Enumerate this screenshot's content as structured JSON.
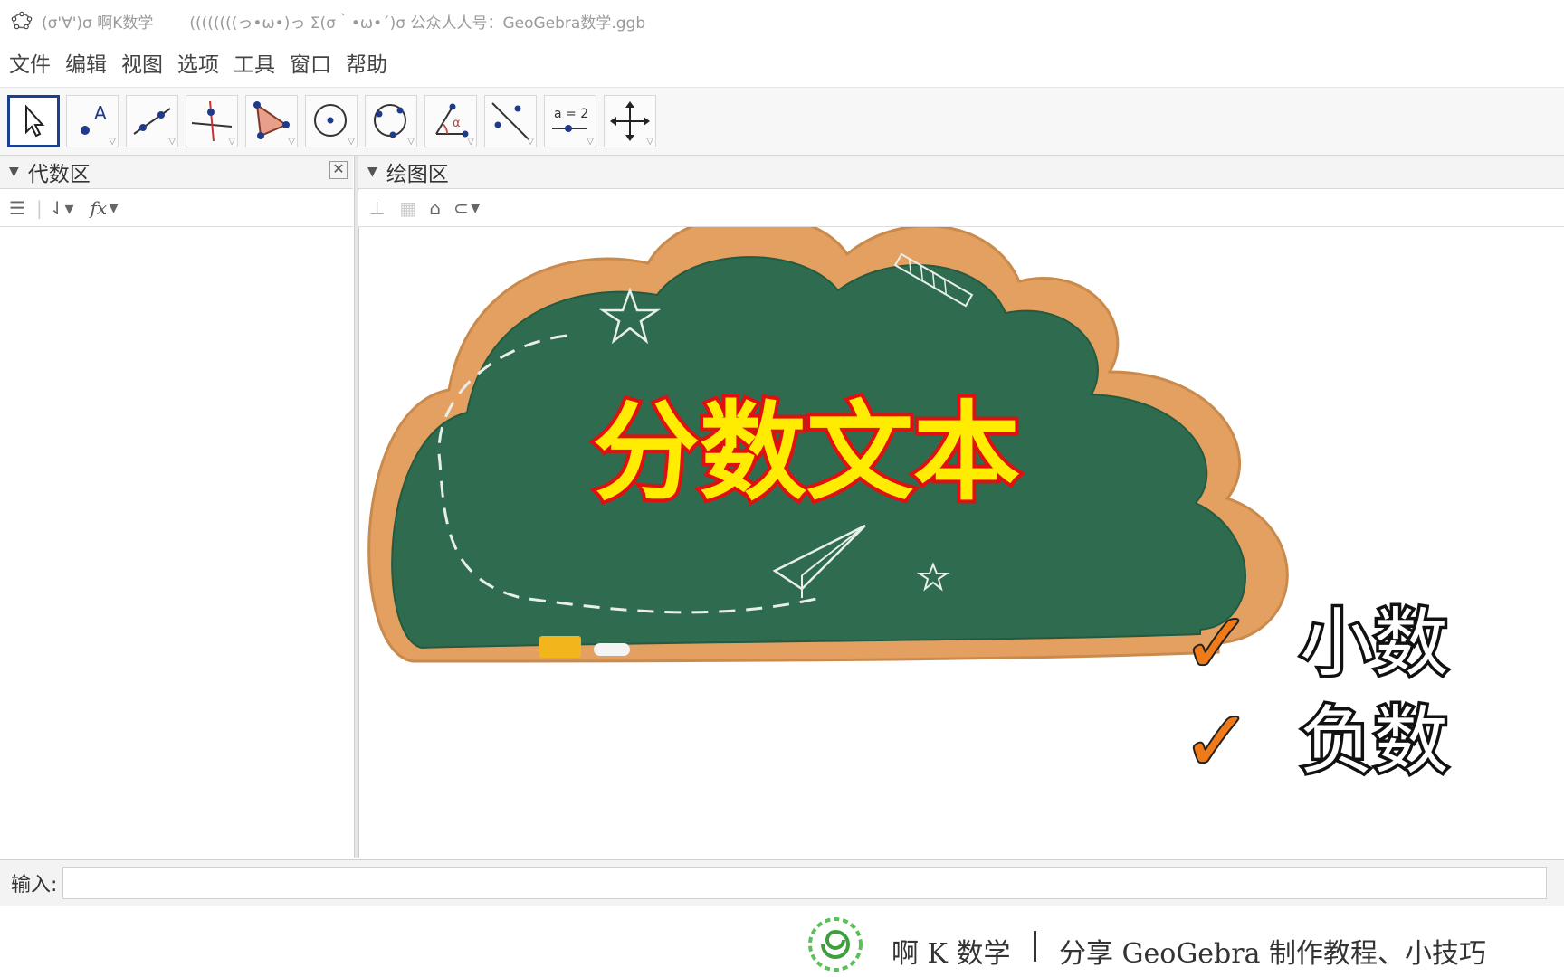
{
  "window": {
    "title_left": "(σ'∀')σ  啊K数学",
    "title_right": "((((((((っ•ω•)っ Σ(σ｀•ω•´)σ  公众人人号：GeoGebra数学.ggb"
  },
  "menu": [
    "文件",
    "编辑",
    "视图",
    "选项",
    "工具",
    "窗口",
    "帮助"
  ],
  "toolbar": {
    "tools": [
      {
        "name": "move-tool-icon"
      },
      {
        "name": "point-tool-icon",
        "label": "A"
      },
      {
        "name": "line-tool-icon"
      },
      {
        "name": "perpendicular-line-tool-icon"
      },
      {
        "name": "polygon-tool-icon"
      },
      {
        "name": "circle-center-tool-icon"
      },
      {
        "name": "circle-three-points-tool-icon"
      },
      {
        "name": "angle-tool-icon",
        "label": "α"
      },
      {
        "name": "reflect-tool-icon"
      },
      {
        "name": "slider-tool-icon",
        "label": "a = 2"
      },
      {
        "name": "move-graphics-view-tool-icon"
      }
    ]
  },
  "algebra": {
    "title": "代数区",
    "fx": "fx"
  },
  "graphics": {
    "title": "绘图区",
    "overlay_title": "分数文本",
    "checks": [
      {
        "mark": "✓",
        "label": "小数"
      },
      {
        "mark": "✓",
        "label": "负数"
      }
    ]
  },
  "input": {
    "label": "输入:",
    "value": ""
  },
  "footer": {
    "brand": "啊 K 数学",
    "slogan": "分享 GeoGebra 制作教程、小技巧"
  },
  "colors": {
    "chalkboard": "#2d6a4f",
    "frame": "#e8a566",
    "title_fill": "#ffec00",
    "title_stroke": "#e01010",
    "check": "#f07a17"
  }
}
